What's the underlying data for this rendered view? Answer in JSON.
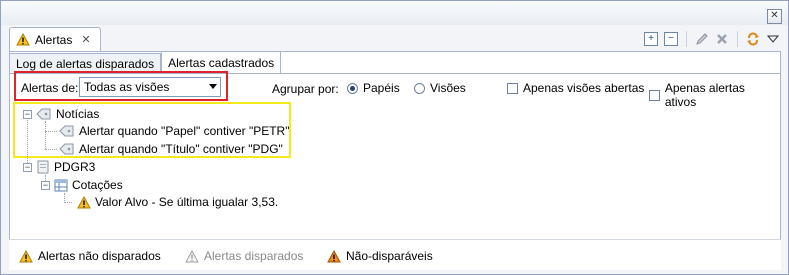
{
  "view": {
    "title": "Alertas",
    "close_glyph": "✕"
  },
  "toolbar": {
    "icons": [
      "expand-all-icon",
      "collapse-all-icon",
      "edit-icon",
      "delete-icon",
      "sync-icon",
      "view-menu-icon"
    ]
  },
  "subtabs": [
    "Log de alertas disparados",
    "Alertas cadastrados"
  ],
  "filters": {
    "alerts_label": "Alertas de:",
    "alerts_value": "Todas as visões",
    "group_label": "Agrupar por:",
    "group_options": [
      "Papéis",
      "Visões"
    ],
    "group_selected": "Papéis",
    "checkboxes": [
      "Apenas visões abertas",
      "Apenas alertas ativos"
    ]
  },
  "tree": {
    "noticias": "Notícias",
    "noticias_items": [
      "Alertar quando \"Papel\" contiver \"PETR\"",
      "Alertar quando \"Título\" contiver \"PDG\""
    ],
    "pdgr3": "PDGR3",
    "cotacoes": "Cotações",
    "valor_alvo": "Valor Alvo - Se última igualar 3,53."
  },
  "legend": [
    "Alertas não disparados",
    "Alertas disparados",
    "Não-disparáveis"
  ],
  "colors": {
    "highlight_red": "#e0222a",
    "highlight_yellow": "#f2ea1d",
    "warning": "#f4c21a"
  }
}
